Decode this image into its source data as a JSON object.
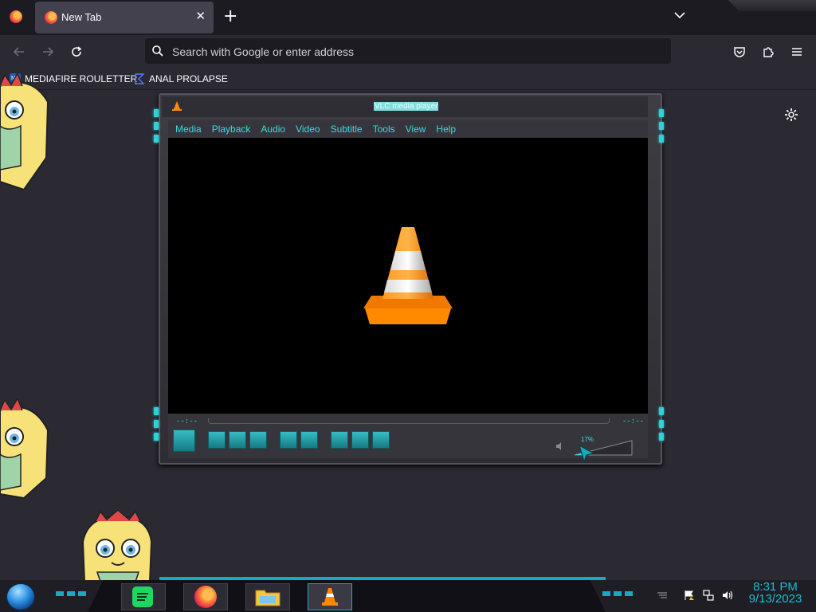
{
  "browser": {
    "tab": {
      "title": "New Tab",
      "close_glyph": "✕",
      "icon": "firefox-icon"
    },
    "new_tab_glyph": "+",
    "urlbar": {
      "placeholder": "Search with Google or enter address"
    },
    "bookmarks": [
      {
        "label": "MEDIAFIRE ROULETTER",
        "icon": "mediafire-icon",
        "icon_text": "MF"
      },
      {
        "label": "ANAL PROLAPSE",
        "icon": "bookmark-sigma-icon"
      }
    ]
  },
  "vlc": {
    "title": "VLC media player",
    "menu": [
      "Media",
      "Playback",
      "Audio",
      "Video",
      "Subtitle",
      "Tools",
      "View",
      "Help"
    ],
    "time_elapsed": "--:--",
    "time_total": "--:--",
    "volume": "17%"
  },
  "taskbar": {
    "time": "8:31 PM",
    "date": "9/13/2023",
    "apps": [
      "spotify-icon",
      "firefox-icon",
      "file-explorer-icon",
      "vlc-icon"
    ]
  },
  "colors": {
    "accent_cyan": "#3fd8e0",
    "taskbar_clock": "#1fbad6"
  }
}
